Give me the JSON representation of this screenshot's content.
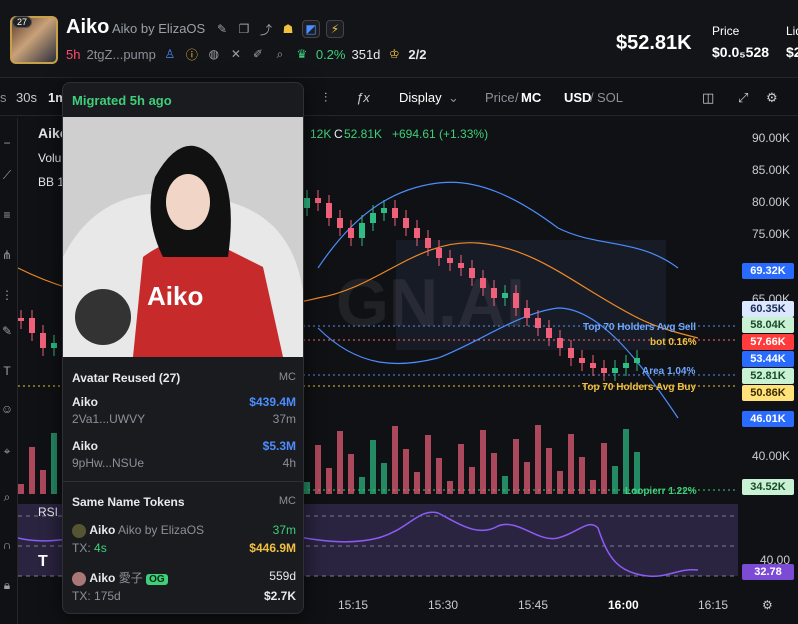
{
  "header": {
    "avatar_badge": "27",
    "ticker": "Aiko",
    "name": "Aiko by ElizaOS",
    "age": "5h",
    "address": "2tgZ...pump",
    "holder_pct": "0.2%",
    "holder_days": "351d",
    "ratio": "2/2",
    "market_cap": "$52.81K",
    "price_label": "Price",
    "price_value": "$0.0₅528",
    "liq_label": "Liq",
    "liq_value": "$2"
  },
  "toolbar": {
    "tf_30s": "30s",
    "tf_1m": "1m",
    "display": "Display",
    "price_label": "Price",
    "mc_label": "MC",
    "usd_label": "USD",
    "sol_label": "SOL"
  },
  "chart_overlay": {
    "symbol": "Aiko",
    "volume_label": "Volu",
    "bb_label": "BB 1",
    "ohlc_h": "12K",
    "ohlc_c_label": "C",
    "ohlc_c": "52.81K",
    "ohlc_change": "+694.61 (+1.33%)",
    "rsi_label": "RSI",
    "watermark": "GN.AI",
    "line_top70_sell": "Top 70 Holders Avg Sell",
    "line_bot": "bot 0.16%",
    "line_area": "Area 1.04%",
    "line_top70_buy": "Top 70 Holders Avg Buy",
    "line_loopierr": "Loopierr 1.22%"
  },
  "y_axis": [
    "90.00K",
    "85.00K",
    "80.00K",
    "75.00K",
    "65.00K",
    "40.00K"
  ],
  "price_pills": [
    {
      "label": "69.32K",
      "bg": "#2a6bff",
      "fg": "#ffffff"
    },
    {
      "label": "60.35K",
      "bg": "#dbe8ff",
      "fg": "#1a2a55"
    },
    {
      "label": "58.04K",
      "bg": "#c9f1d4",
      "fg": "#1a4a2a"
    },
    {
      "label": "57.66K",
      "bg": "#ff3b3b",
      "fg": "#ffffff"
    },
    {
      "label": "53.44K",
      "bg": "#2a6bff",
      "fg": "#ffffff"
    },
    {
      "label": "52.81K",
      "bg": "#c9f1d4",
      "fg": "#1a4a2a"
    },
    {
      "label": "50.86K",
      "bg": "#ffe27a",
      "fg": "#3a2a00"
    },
    {
      "label": "46.01K",
      "bg": "#2a6bff",
      "fg": "#ffffff"
    },
    {
      "label": "34.52K",
      "bg": "#c9f1d4",
      "fg": "#1a4a2a"
    },
    {
      "label": "32.78",
      "bg": "#7b4bd6",
      "fg": "#ffffff"
    }
  ],
  "x_axis": [
    "15:15",
    "15:30",
    "15:45",
    "16:00",
    "16:15"
  ],
  "popup": {
    "header": "Migrated 5h ago",
    "image_text": "Aiko",
    "sec1_title": "Avatar Reused (27)",
    "sec1_col": "MC",
    "items": [
      {
        "name": "Aiko",
        "mc": "$439.4M",
        "addr": "2Va1...UWVY",
        "age": "37m"
      },
      {
        "name": "Aiko",
        "mc": "$5.3M",
        "addr": "9pHw...NSUe",
        "age": "4h"
      }
    ],
    "sec2_title": "Same Name Tokens",
    "sec2_col": "MC",
    "tokens": [
      {
        "name": "Aiko",
        "sub": "Aiko by ElizaOS",
        "age": "37m",
        "tx_label": "TX:",
        "tx": "4s",
        "mc": "$446.9M"
      },
      {
        "name": "Aiko",
        "sub": "愛子",
        "badge": "OG",
        "age": "559d",
        "tx_label": "TX:",
        "tx": "175d",
        "mc": "$2.7K"
      }
    ]
  }
}
